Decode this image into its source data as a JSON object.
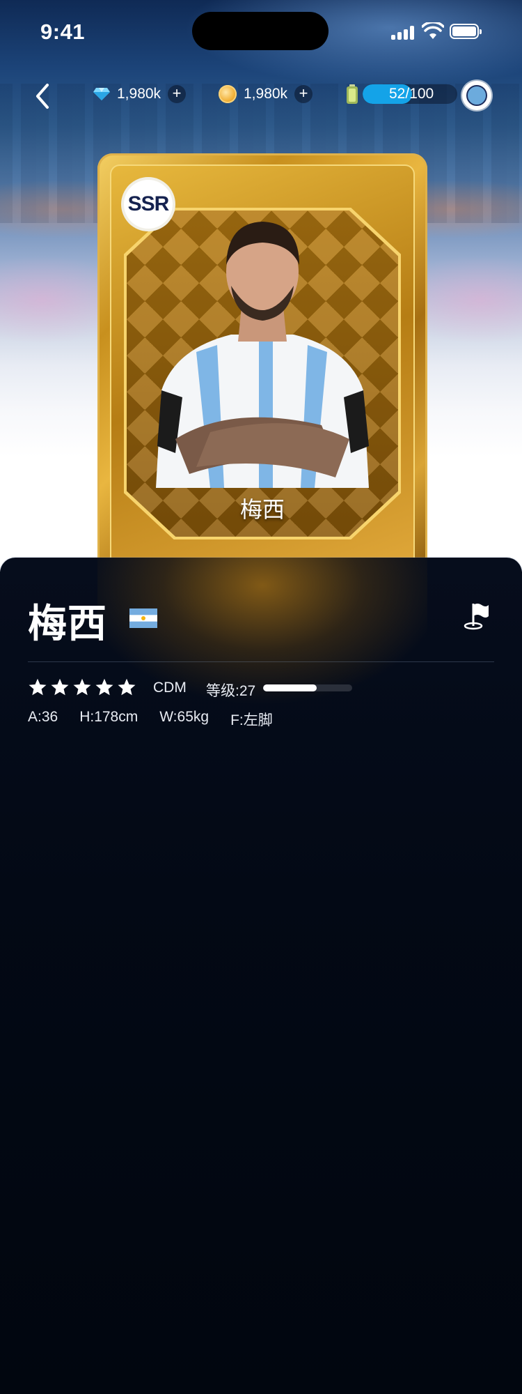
{
  "status_bar": {
    "time": "9:41"
  },
  "resources": {
    "gems": {
      "icon": "diamond-icon",
      "value": "1,980k",
      "add": "+"
    },
    "coins": {
      "icon": "coin-icon",
      "value": "1,980k",
      "add": "+"
    },
    "energy": {
      "icon": "battery-icon",
      "current": "52",
      "max": "100",
      "separator": "/",
      "fill_fraction": 0.52,
      "color": "#14a3e8"
    }
  },
  "card": {
    "rarity": "SSR",
    "name": "梅西"
  },
  "player": {
    "name": "梅西",
    "nation_flag": "argentina-flag-icon",
    "stars": 5,
    "position": "CDM",
    "level_label": "等级:",
    "level": "27",
    "level_progress": 0.6,
    "attributes": [
      {
        "label": "A:36"
      },
      {
        "label": "H:178cm"
      },
      {
        "label": "W:65kg"
      },
      {
        "label": "F:左脚"
      }
    ]
  },
  "colors": {
    "accent_blue": "#14a3e8",
    "gold": "#d9a435",
    "panel_bg": "#01060f"
  }
}
